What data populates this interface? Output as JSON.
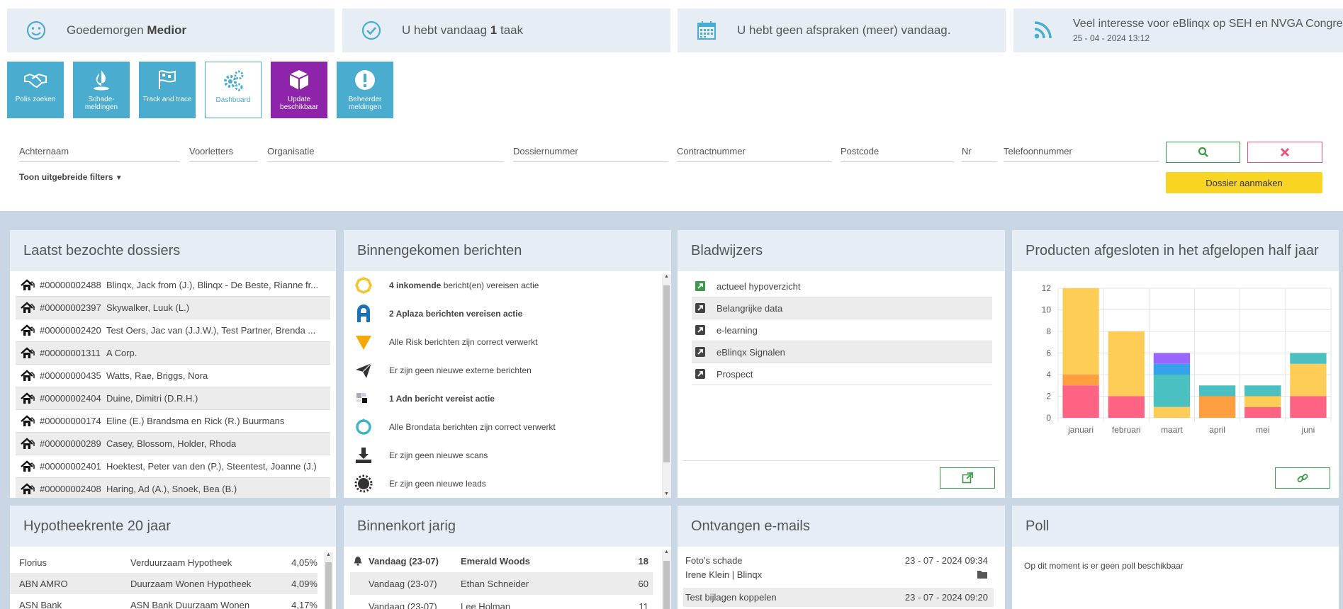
{
  "header": {
    "greeting_prefix": "Goedemorgen",
    "greeting_name": "Medior",
    "tasks_prefix": "U hebt vandaag",
    "tasks_count": "1",
    "tasks_suffix": "taak",
    "appointments": "U hebt geen afspraken (meer) vandaag.",
    "news_title": "Veel interesse voor eBlinqx op SEH en NVGA Congres",
    "news_date": "25 - 04 - 2024 13:12"
  },
  "tiles": [
    {
      "label1": "Polis zoeken",
      "label2": ""
    },
    {
      "label1": "Schade-",
      "label2": "meldingen"
    },
    {
      "label1": "Track and trace",
      "label2": ""
    },
    {
      "label1": "Dashboard",
      "label2": ""
    },
    {
      "label1": "Update",
      "label2": "beschikbaar"
    },
    {
      "label1": "Beheerder",
      "label2": "meldingen"
    }
  ],
  "search": {
    "achternaam": "Achternaam",
    "voorletters": "Voorletters",
    "organisatie": "Organisatie",
    "dossiernummer": "Dossiernummer",
    "contractnummer": "Contractnummer",
    "postcode": "Postcode",
    "nr": "Nr",
    "telefoonnummer": "Telefoonnummer",
    "filters": "Toon uitgebreide filters",
    "create": "Dossier aanmaken"
  },
  "dossiers": {
    "title": "Laatst bezochte dossiers",
    "items": [
      {
        "num": "#00000002488",
        "name": "Blinqx, Jack from (J.), Blinqx - De Beste, Rianne fr..."
      },
      {
        "num": "#00000002397",
        "name": "Skywalker, Luuk (L.)"
      },
      {
        "num": "#00000002420",
        "name": "Test Oers, Jac van (J.J.W.), Test Partner, Brenda ..."
      },
      {
        "num": "#00000001311",
        "name": "A Corp."
      },
      {
        "num": "#00000000435",
        "name": "Watts, Rae, Briggs, Nora"
      },
      {
        "num": "#00000002404",
        "name": "Duine, Dimitri (D.R.H.)"
      },
      {
        "num": "#00000000174",
        "name": "Eline (E.) Brandsma en Rick (R.) Buurmans"
      },
      {
        "num": "#00000000289",
        "name": "Casey, Blossom, Holder, Rhoda"
      },
      {
        "num": "#00000002401",
        "name": "Hoektest, Peter van den (P.), Steentest, Joanne (J.)"
      },
      {
        "num": "#00000002408",
        "name": "Haring, Ad (A.), Snoek, Bea (B.)"
      }
    ]
  },
  "messages": {
    "title": "Binnengekomen berichten",
    "items": [
      {
        "bold": "4 inkomende",
        "text": " bericht(en) vereisen actie"
      },
      {
        "bold": "2 Aplaza berichten vereisen actie",
        "text": ""
      },
      {
        "bold": "",
        "text": "Alle Risk berichten zijn correct verwerkt"
      },
      {
        "bold": "",
        "text": "Er zijn geen nieuwe externe berichten"
      },
      {
        "bold": "1 Adn bericht vereist actie",
        "text": ""
      },
      {
        "bold": "",
        "text": "Alle Brondata berichten zijn correct verwerkt"
      },
      {
        "bold": "",
        "text": "Er zijn geen nieuwe scans"
      },
      {
        "bold": "",
        "text": "Er zijn geen nieuwe leads"
      }
    ]
  },
  "bookmarks": {
    "title": "Bladwijzers",
    "items": [
      "actueel hypoverzicht",
      "Belangrijke data",
      "e-learning",
      "eBlinqx Signalen",
      "Prospect"
    ]
  },
  "products": {
    "title": "Producten afgesloten in het afgelopen half jaar"
  },
  "chart_data": {
    "type": "bar",
    "stacked": true,
    "categories": [
      "januari",
      "februari",
      "maart",
      "april",
      "mei",
      "juni"
    ],
    "series": [
      {
        "color": "#ff6384",
        "values": [
          3,
          2,
          0,
          0,
          1,
          2
        ]
      },
      {
        "color": "#ff9f40",
        "values": [
          1,
          0,
          0,
          2,
          0,
          0
        ]
      },
      {
        "color": "#ffcd56",
        "values": [
          8,
          6,
          1,
          0,
          1,
          3
        ]
      },
      {
        "color": "#4bc0c0",
        "values": [
          0,
          0,
          3,
          1,
          1,
          1
        ]
      },
      {
        "color": "#36a2eb",
        "values": [
          0,
          0,
          1,
          0,
          0,
          0
        ]
      },
      {
        "color": "#9966ff",
        "values": [
          0,
          0,
          1,
          0,
          0,
          0
        ]
      }
    ],
    "ylim": [
      0,
      12
    ],
    "yticks": [
      0,
      2,
      4,
      6,
      8,
      10,
      12
    ],
    "grid": true
  },
  "rates": {
    "title": "Hypotheekrente 20 jaar",
    "items": [
      {
        "bank": "Florius",
        "product": "Verduurzaam Hypotheek",
        "rate": "4,05%"
      },
      {
        "bank": "ABN AMRO",
        "product": "Duurzaam Wonen Hypotheek",
        "rate": "4,09%"
      },
      {
        "bank": "ASN Bank",
        "product": "ASN Bank Duurzaam Wonen",
        "rate": "4,17%"
      }
    ]
  },
  "birthdays": {
    "title": "Binnenkort jarig",
    "items": [
      {
        "date": "Vandaag (23-07)",
        "name": "Emerald Woods",
        "age": "18"
      },
      {
        "date": "Vandaag (23-07)",
        "name": "Ethan Schneider",
        "age": "60"
      },
      {
        "date": "Vandaag (23-07)",
        "name": "Lee Holman",
        "age": "11"
      }
    ]
  },
  "emails": {
    "title": "Ontvangen e-mails",
    "items": [
      {
        "subject": "Foto's schade",
        "date": "23 - 07 - 2024 09:34",
        "from": "Irene Klein | Blinqx"
      },
      {
        "subject": "Test bijlagen koppelen",
        "date": "23 - 07 - 2024 09:20",
        "from": ""
      }
    ]
  },
  "poll": {
    "title": "Poll",
    "text": "Op dit moment is er geen poll beschikbaar"
  }
}
